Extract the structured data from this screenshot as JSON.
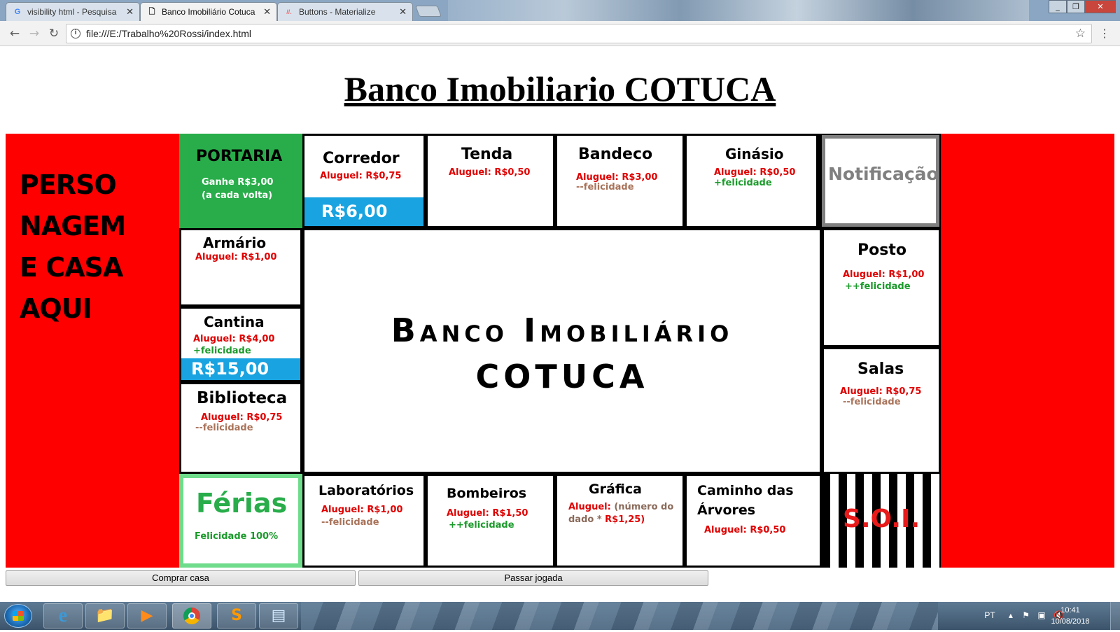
{
  "browser": {
    "tabs": [
      {
        "icon": "G",
        "title": "visibility html - Pesquisa"
      },
      {
        "icon": "🗋",
        "title": "Banco Imobiliário Cotuca"
      },
      {
        "icon": "//.",
        "title": "Buttons - Materialize"
      }
    ],
    "close_glyph": "✕",
    "url": "file:///E:/Trabalho%20Rossi/index.html",
    "window_buttons": {
      "minimize": "_",
      "restore": "❐",
      "close": "✕"
    }
  },
  "page": {
    "title": "Banco Imobiliario COTUCA",
    "left_panel_text": "PERSONAGEM E CASA AQUI",
    "center_title_line1": "Banco Imobiliário",
    "center_title_line2": "COTUCA",
    "soi": "S.O.I.",
    "buttons": {
      "buy": "Comprar casa",
      "pass": "Passar jogada"
    }
  },
  "board": {
    "portaria": {
      "name": "PORTARIA",
      "line1": "Ganhe R$3,00",
      "line2": "(a cada volta)"
    },
    "corredor": {
      "name": "Corredor",
      "rent": "Aluguel: R$0,75",
      "price": "R$6,00"
    },
    "tenda": {
      "name": "Tenda",
      "rent": "Aluguel: R$0,50"
    },
    "bandeco": {
      "name": "Bandeco",
      "rent": "Aluguel: R$3,00",
      "fel": "--felicidade"
    },
    "ginasio": {
      "name": "Ginásio",
      "rent": "Aluguel: R$0,50",
      "fel": "+felicidade"
    },
    "notificacao": {
      "name": "Notificação"
    },
    "armario": {
      "name": "Armário",
      "rent": "Aluguel: R$1,00"
    },
    "cantina": {
      "name": "Cantina",
      "rent": "Aluguel: R$4,00",
      "fel": "+felicidade",
      "price": "R$15,00"
    },
    "biblioteca": {
      "name": "Biblioteca",
      "rent": "Aluguel: R$0,75",
      "fel": "--felicidade"
    },
    "posto": {
      "name": "Posto",
      "rent": "Aluguel: R$1,00",
      "fel": "++felicidade"
    },
    "salas": {
      "name": "Salas",
      "rent": "Aluguel: R$0,75",
      "fel": "--felicidade"
    },
    "ferias": {
      "name": "Férias",
      "sub": "Felicidade 100%"
    },
    "laboratorios": {
      "name": "Laboratórios",
      "rent": "Aluguel: R$1,00",
      "fel": "--felicidade"
    },
    "bombeiros": {
      "name": "Bombeiros",
      "rent": "Aluguel: R$1,50",
      "fel": "++felicidade"
    },
    "grafica": {
      "name": "Gráfica",
      "rent_label": "Aluguel:",
      "rent_rest1": " (número do",
      "rent_line2a": "dado * ",
      "rent_line2b": "R$1,25)"
    },
    "caminho": {
      "name_line1": "Caminho das",
      "name_line2": "Árvores",
      "rent": "Aluguel: R$0,50"
    }
  },
  "taskbar": {
    "lang": "PT",
    "time": "10:41",
    "date": "10/08/2018"
  },
  "colors": {
    "side_panels": "#ff0000",
    "portaria": "#28ad4a",
    "price_tag": "#19a3e0",
    "rent": "#e00000",
    "fel_pos": "#1a9a2a",
    "fel_neg": "#a9735a",
    "ferias_border": "#6fdc8c",
    "notificacao_border": "#808080"
  }
}
